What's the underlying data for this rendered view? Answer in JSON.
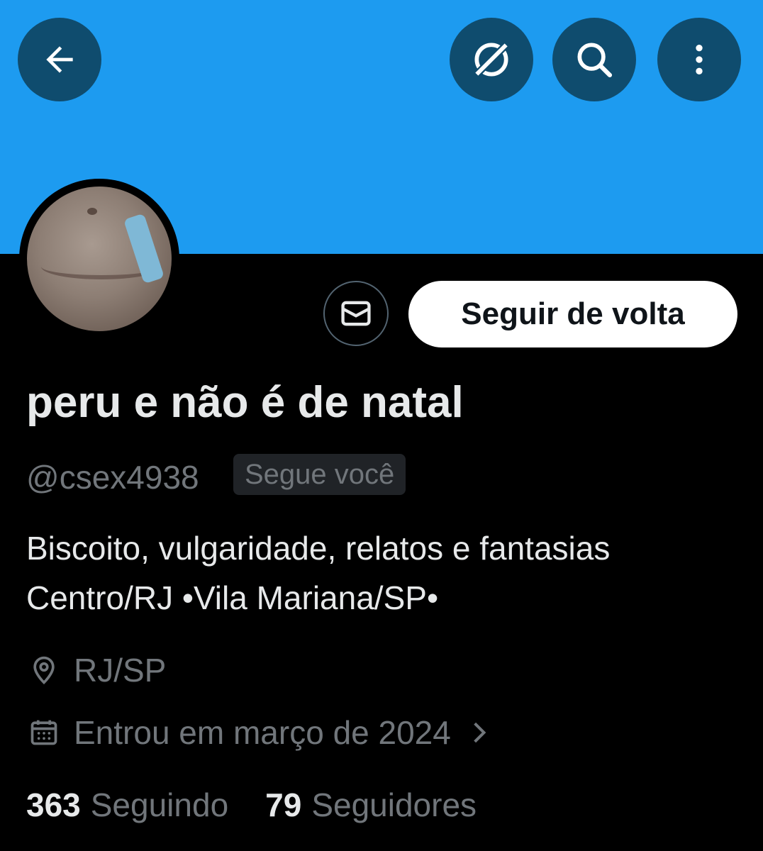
{
  "header": {
    "back_icon": "arrow-left-icon",
    "grok_icon": "grok-icon",
    "search_icon": "search-icon",
    "more_icon": "more-vertical-icon",
    "banner_color": "#1D9BF0"
  },
  "profile": {
    "display_name": "peru e não é de natal",
    "handle": "@csex4938",
    "follows_you_badge": "Segue você",
    "bio_line1": "Biscoito, vulgaridade, relatos e fantasias",
    "bio_line2": "Centro/RJ •Vila Mariana/SP•",
    "location": "RJ/SP",
    "joined": "Entrou em março de 2024",
    "following_count": "363",
    "following_label": "Seguindo",
    "followers_count": "79",
    "followers_label": "Seguidores"
  },
  "actions": {
    "message_icon": "mail-icon",
    "follow_back_label": "Seguir de volta"
  }
}
